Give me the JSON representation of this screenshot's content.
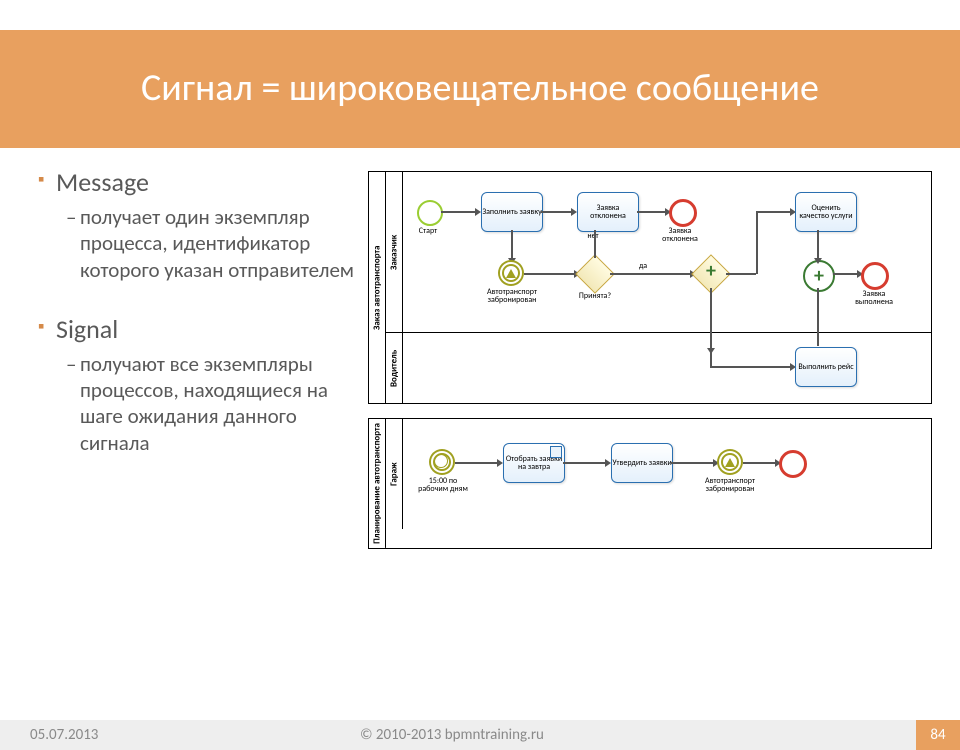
{
  "title": "Сигнал = широковещательное сообщение",
  "bullets": [
    {
      "head": "Message",
      "sub": "получает один экземпляр процесса, идентификатор которого указан отправителем"
    },
    {
      "head": "Signal",
      "sub": "получают все экземпляры процессов, находящиеся на шаге ожидания данного сигнала"
    }
  ],
  "diagram": {
    "pool1": {
      "title": "Заказ автотранспорта",
      "lane_a": "Заказчик",
      "lane_b": "Водитель",
      "start": "Старт",
      "task1": "Заполнить заявку",
      "task2": "Заявка отклонена",
      "end1": "Заявка отклонена",
      "gw": "Принята?",
      "gw_no": "нет",
      "gw_yes": "да",
      "sigcatch": "Автотранспорт забронирован",
      "task3": "Оценить качество услуги",
      "end2": "Заявка выполнена",
      "task4": "Выполнить рейс"
    },
    "pool2": {
      "title": "Планирование автотранспорта",
      "lane": "Гараж",
      "timer": "15:00 по рабочим дням",
      "task1": "Отобрать заявки на завтра",
      "task2": "Утвердить заявки",
      "sigthrow": "Автотранспорт забронирован"
    }
  },
  "footer": {
    "date": "05.07.2013",
    "copy": "© 2010-2013 bpmntraining.ru",
    "page": "84"
  }
}
